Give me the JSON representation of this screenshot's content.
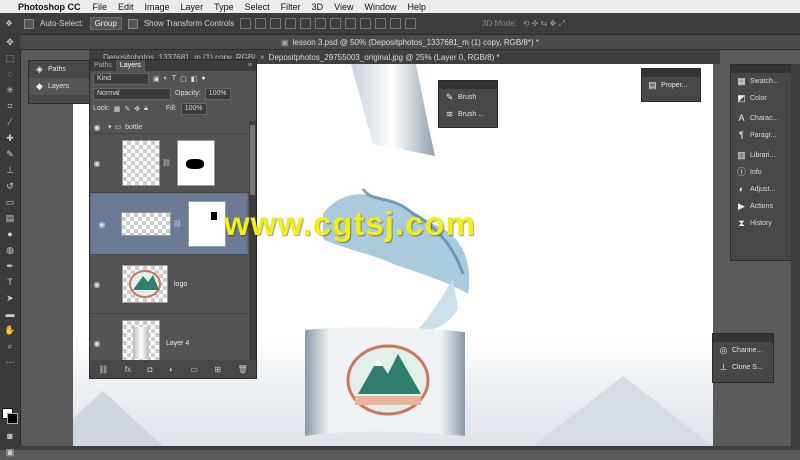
{
  "menubar": {
    "app_name": "Photoshop CC",
    "items": [
      "File",
      "Edit",
      "Image",
      "Layer",
      "Type",
      "Select",
      "Filter",
      "3D",
      "View",
      "Window",
      "Help"
    ]
  },
  "options": {
    "auto_select_label": "Auto-Select:",
    "auto_select_value": "Group",
    "transform_label": "Show Transform Controls",
    "mode_label": "3D Mode:"
  },
  "documents": {
    "tab_back": "Depositphotos_1337681_m (1) copy, RGB/8*",
    "tab_main": "lesson 3.psd @ 50% (Depositphotos_1337681_m (1) copy, RGB/8*) *",
    "tab_front": "Depositphotos_29755003_original.jpg @ 25% (Layer 0, RGB/8) *"
  },
  "paths_panel": {
    "paths": "Paths",
    "layers": "Layers"
  },
  "layers_panel": {
    "tab_paths": "Paths",
    "tab_layers": "Layers",
    "kind": "Kind",
    "blend": "Normal",
    "opacity_label": "Opacity:",
    "opacity": "100%",
    "lock_label": "Lock:",
    "fill_label": "Fill:",
    "fill": "100%",
    "group_name": "bottle",
    "layers": [
      {
        "name": ""
      },
      {
        "name": ""
      },
      {
        "name": "logo"
      },
      {
        "name": "Layer 4"
      }
    ]
  },
  "brush_panel": {
    "brush": "Brush",
    "brush_presets": "Brush ..."
  },
  "properties_panel": {
    "label": "Proper..."
  },
  "right_panels": [
    "Swatch...",
    "Color",
    "Charac...",
    "Paragr...",
    "Librari...",
    "Info",
    "Adjust...",
    "Actions",
    "History"
  ],
  "channels_panel": {
    "channels": "Channe...",
    "clone": "Clone S..."
  },
  "watermark": "www.cgtsj.com",
  "colors": {
    "accent_selected_layer": "#6b7a95",
    "watermark": "#f3f010"
  }
}
